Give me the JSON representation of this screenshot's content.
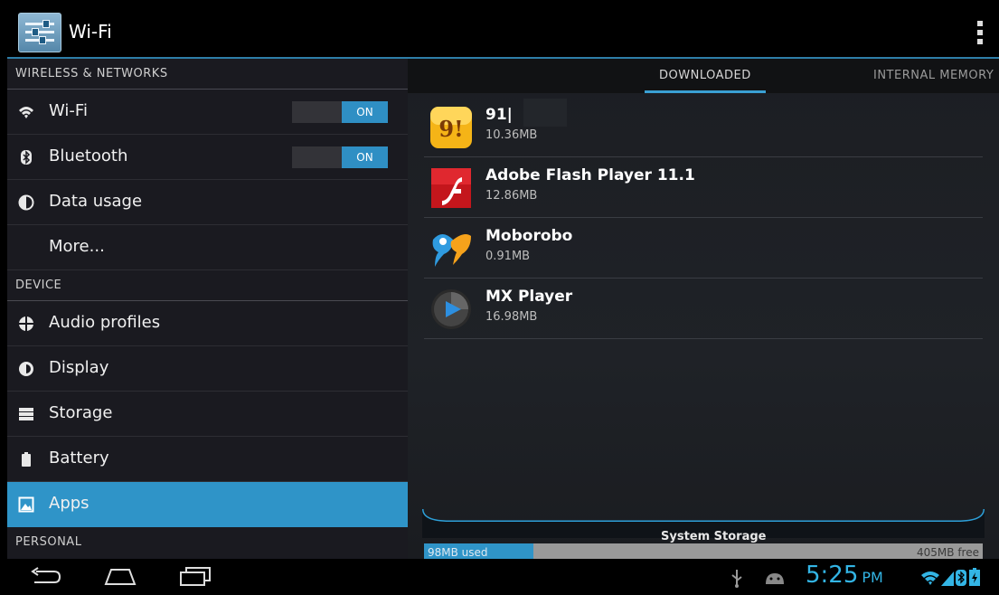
{
  "action_bar": {
    "title": "Wi-Fi"
  },
  "left_pane": {
    "sections": [
      {
        "header": "WIRELESS & NETWORKS"
      },
      {
        "header": "DEVICE"
      },
      {
        "header": "PERSONAL"
      }
    ],
    "items": [
      {
        "label": "Wi-Fi",
        "icon": "wifi-icon",
        "toggle": "ON"
      },
      {
        "label": "Bluetooth",
        "icon": "bluetooth-icon",
        "toggle": "ON"
      },
      {
        "label": "Data usage",
        "icon": "data-usage-icon"
      },
      {
        "label": "More..."
      },
      {
        "label": "Audio profiles",
        "icon": "audio-profiles-icon"
      },
      {
        "label": "Display",
        "icon": "display-icon"
      },
      {
        "label": "Storage",
        "icon": "storage-icon"
      },
      {
        "label": "Battery",
        "icon": "battery-icon"
      },
      {
        "label": "Apps",
        "icon": "apps-icon",
        "selected": true
      }
    ]
  },
  "tabs": [
    {
      "label": "DOWNLOADED",
      "selected": true
    },
    {
      "label": "INTERNAL MEMORY"
    }
  ],
  "apps": [
    {
      "name": "91|",
      "size": "10.36MB",
      "icon": "91-app-icon"
    },
    {
      "name": "Adobe Flash Player 11.1",
      "size": "12.86MB",
      "icon": "flash-player-icon"
    },
    {
      "name": "Moborobo",
      "size": "0.91MB",
      "icon": "moborobo-icon"
    },
    {
      "name": "MX Player",
      "size": "16.98MB",
      "icon": "mx-player-icon"
    }
  ],
  "storage": {
    "label": "System Storage",
    "used": "98MB used",
    "free": "405MB free",
    "used_fraction": 0.195
  },
  "status_bar": {
    "time": "5:25",
    "ampm": "PM"
  },
  "colors": {
    "accent": "#33b5e5",
    "selected_row": "#2f94c8"
  }
}
